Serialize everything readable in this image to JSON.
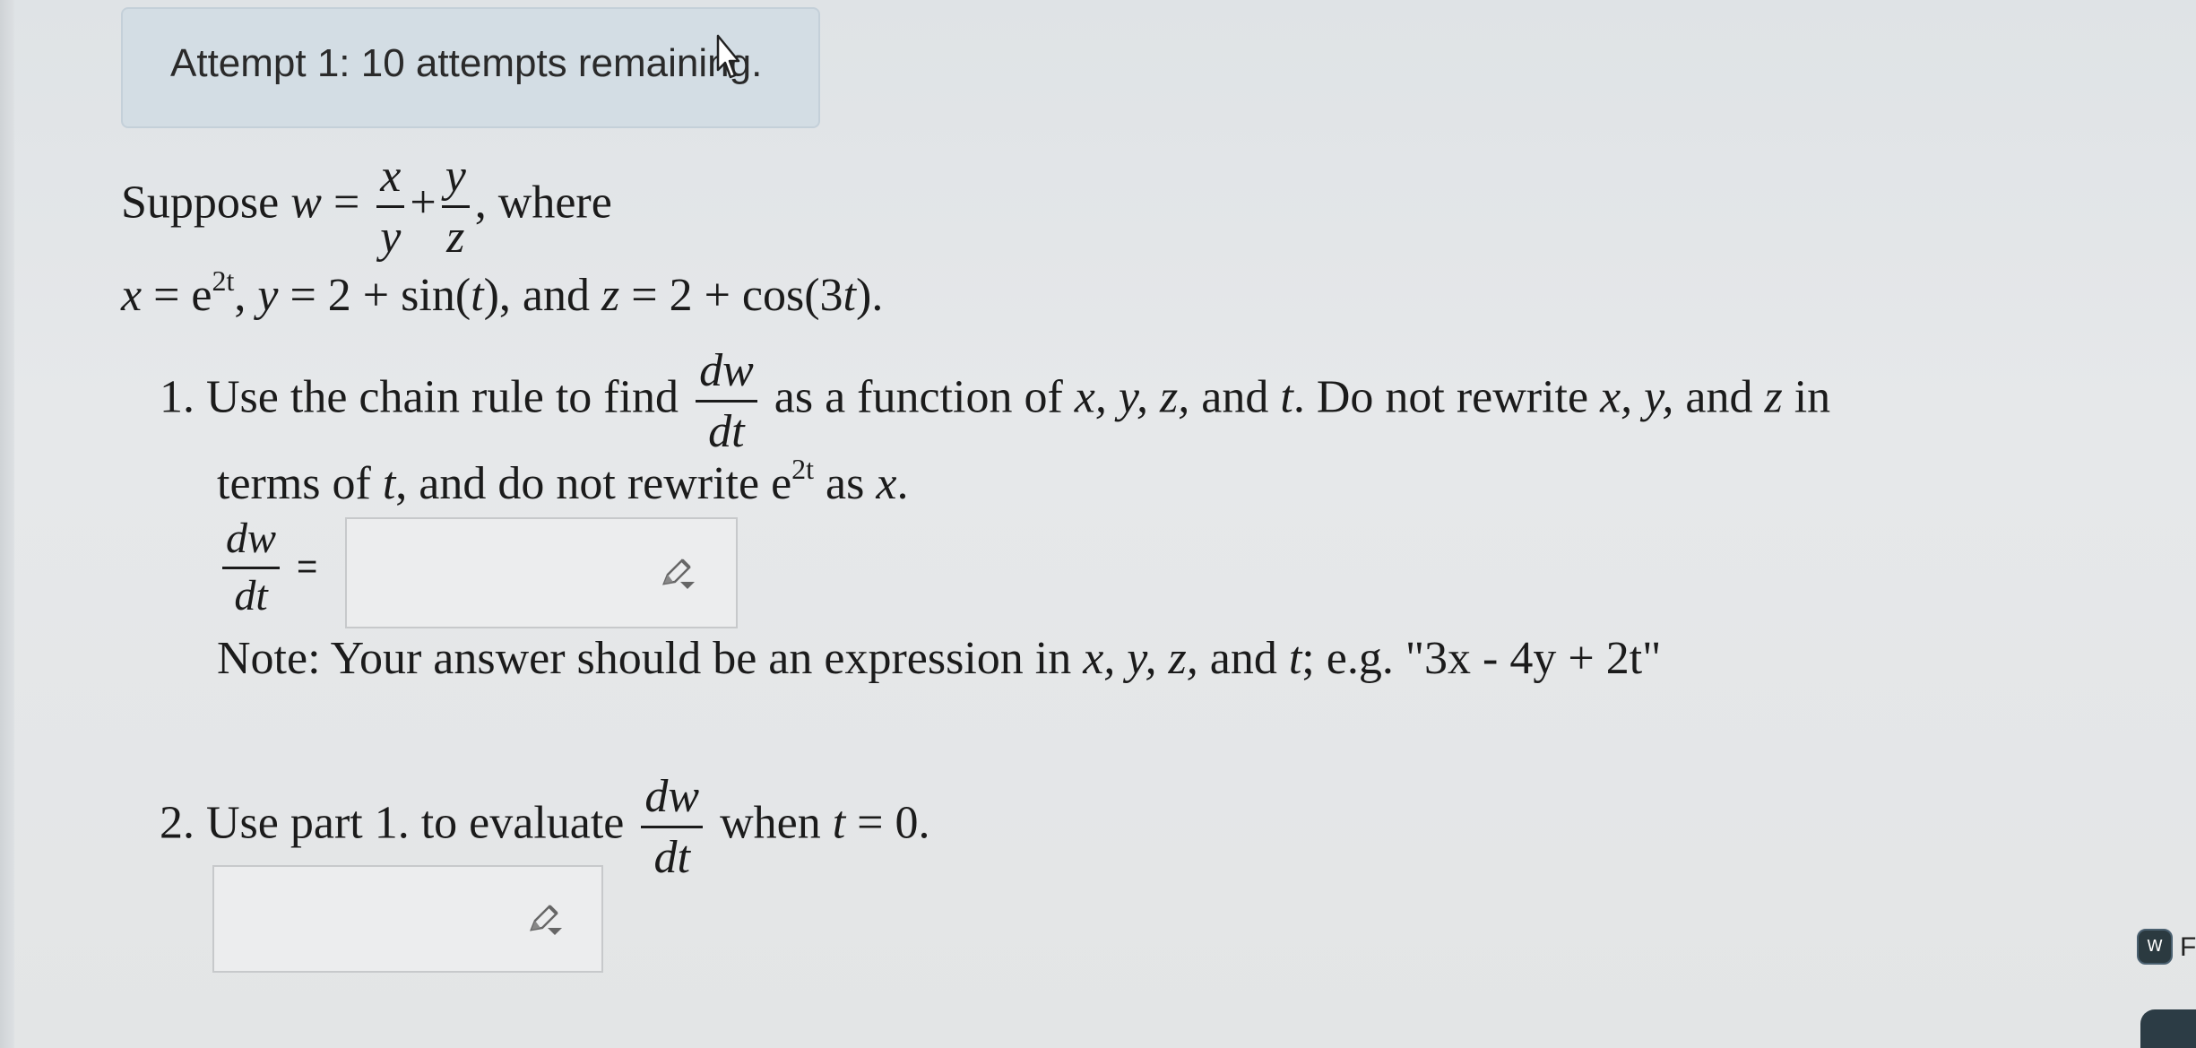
{
  "attempt": {
    "text": "Attempt 1: 10 attempts remaining."
  },
  "problem": {
    "intro_word": "Suppose",
    "w_var": "w",
    "eq": "=",
    "x": "x",
    "y": "y",
    "z": "z",
    "plus": "+",
    "where": ", where",
    "line2": {
      "x_part": "x",
      "eq_e": " = e",
      "exp": "2t",
      "rest_y_a": ",  ",
      "y_var": "y",
      "rest_y_b": " = 2 + sin(",
      "t1": "t",
      "rest_and": "), and ",
      "z_var": "z",
      "rest_z": " = 2 + cos(3",
      "t2": "t",
      "end": ")."
    }
  },
  "part1": {
    "lead": "1. Use the chain rule to find",
    "dw": "dw",
    "dt": "dt",
    "after": "as a function of ",
    "vars": "x, y, z,",
    "and": " and ",
    "t": "t",
    "dont": ". Do not rewrite ",
    "vars2": "x, y,",
    "and2": " and ",
    "z": "z",
    "in": " in",
    "line2a": "terms of ",
    "line2t": "t",
    "line2b": ", and do not rewrite e",
    "line2exp": "2t",
    "line2c": " as ",
    "line2x": "x",
    "line2d": ".",
    "equals": "=",
    "note_a": "Note: Your answer should be an expression in ",
    "note_vars": "x, y, z,",
    "note_b": " and ",
    "note_t": "t",
    "note_c": "; e.g. \"3x - 4y + 2t\""
  },
  "part2": {
    "lead": "2. Use part 1. to evaluate",
    "dw": "dw",
    "dt": "dt",
    "when": "when ",
    "t": "t",
    "eq": " = 0."
  },
  "answer1": {
    "value": ""
  },
  "answer2": {
    "value": ""
  },
  "icons": {
    "pencil": "pencil-dropdown-icon",
    "cursor": "mouse-pointer-icon",
    "badge": "app-badge-icon"
  },
  "corner": {
    "badge_text": "W",
    "letter": "F"
  }
}
